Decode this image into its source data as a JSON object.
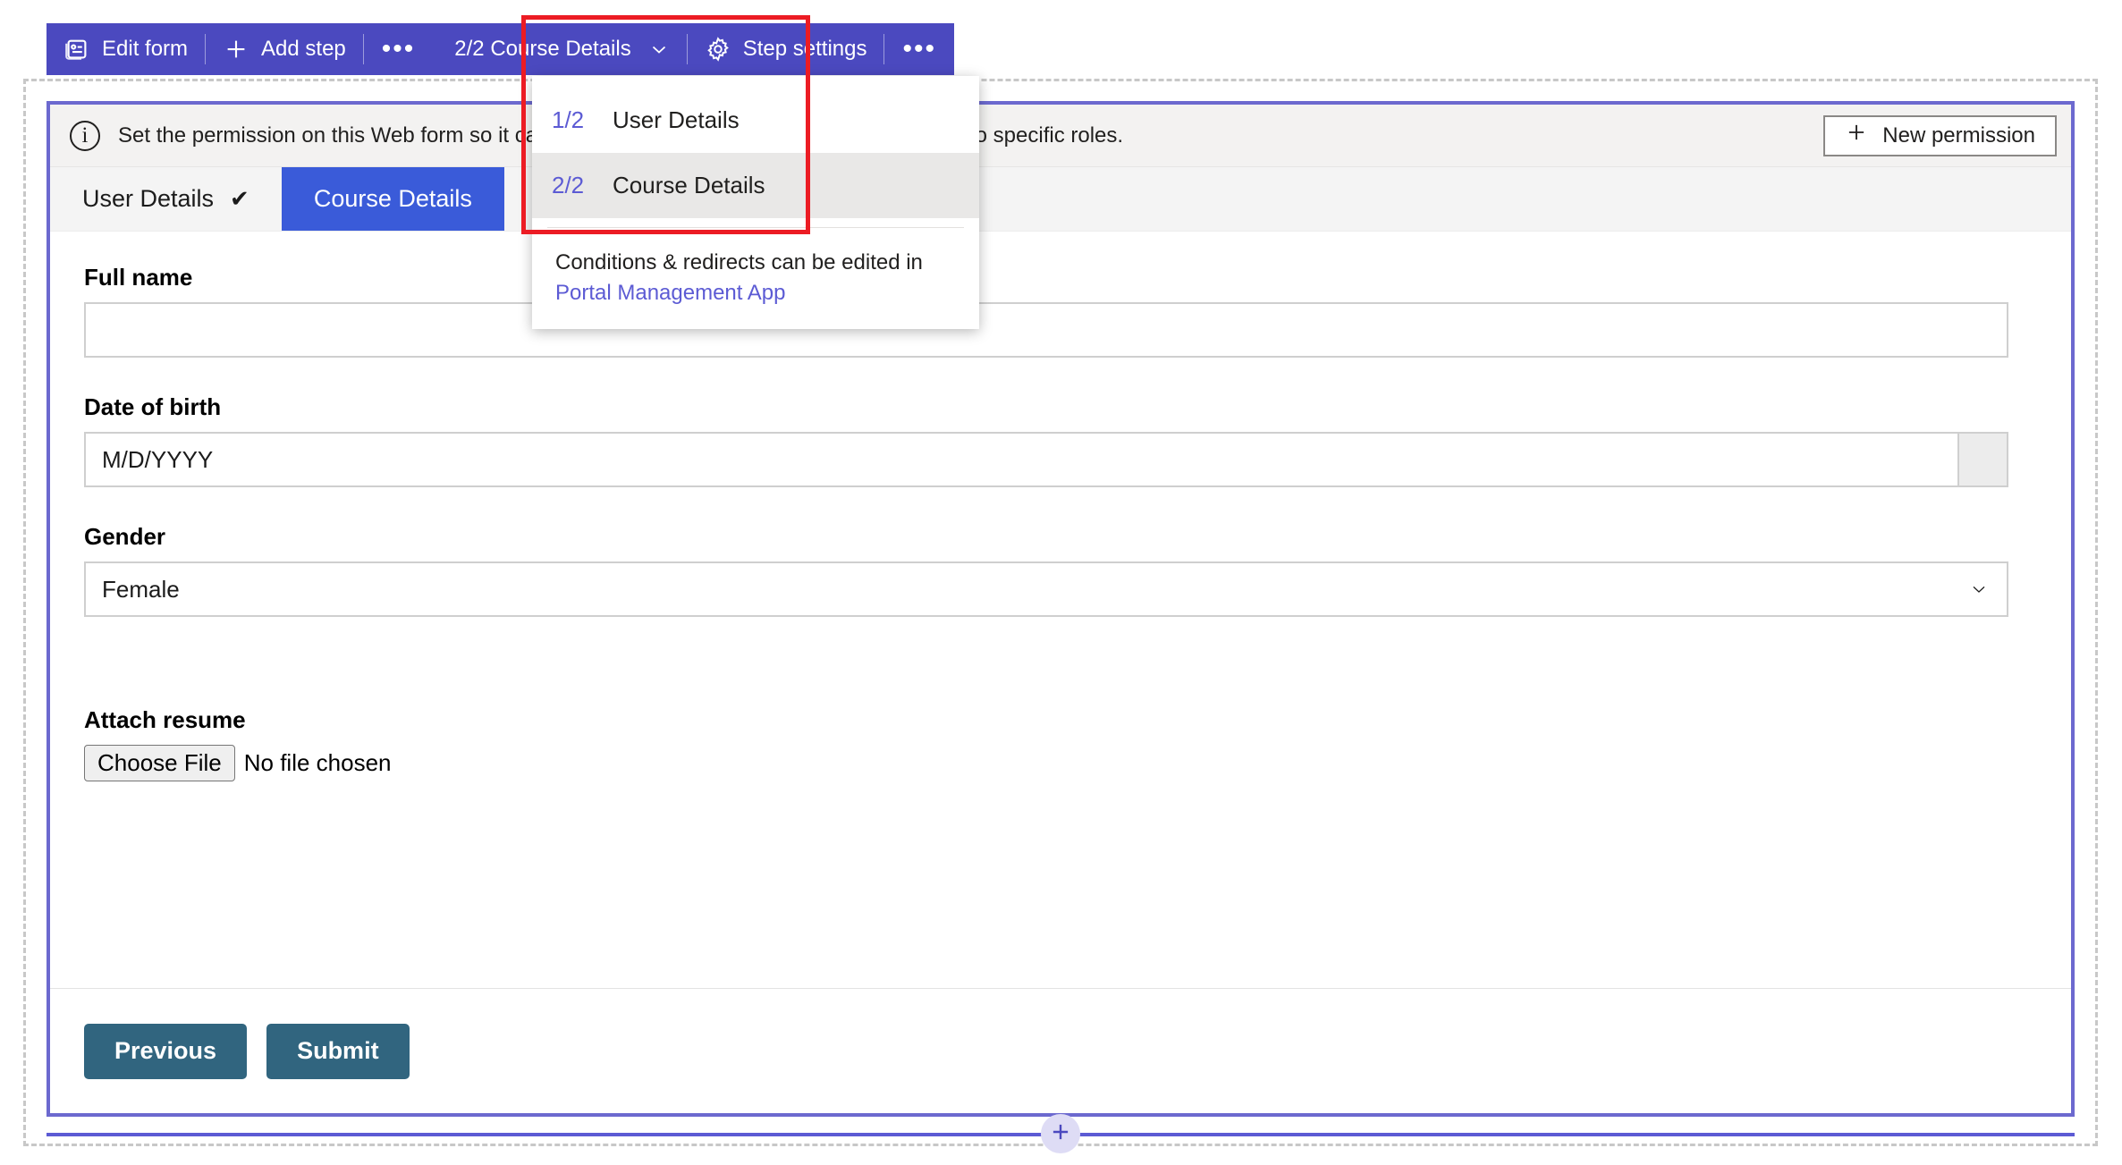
{
  "toolbar": {
    "edit_form_label": "Edit form",
    "edit_form_icon": "form-icon",
    "add_step_label": "Add step",
    "add_step_icon": "plus-icon",
    "overflow_left_label": "•••",
    "step_selector_label": "2/2 Course Details",
    "step_selector_caret_icon": "chevron-down-icon",
    "step_settings_label": "Step settings",
    "step_settings_icon": "gear-icon",
    "overflow_right_label": "•••",
    "accent_color": "#4b49bf"
  },
  "step_menu": {
    "items": [
      {
        "number": "1/2",
        "label": "User Details",
        "selected": false
      },
      {
        "number": "2/2",
        "label": "Course Details",
        "selected": true
      }
    ],
    "note_text": "Conditions & redirects can be edited in",
    "note_link": "Portal Management App"
  },
  "highlight": {
    "color": "#ec1c24"
  },
  "permission_bar": {
    "info_icon": "info-icon",
    "info_glyph": "i",
    "message": "Set the permission on this Web form so it can be accessed publicly or limit the interaction to specific roles.",
    "new_permission_label": "New permission",
    "new_permission_icon": "plus-icon"
  },
  "tabs": [
    {
      "label": "User Details",
      "active": false,
      "check_icon": "check-icon",
      "check_glyph": "✔"
    },
    {
      "label": "Course Details",
      "active": true,
      "check_icon": "",
      "check_glyph": ""
    }
  ],
  "form": {
    "fields": {
      "full_name": {
        "label": "Full name",
        "value": "",
        "placeholder": ""
      },
      "date_of_birth": {
        "label": "Date of birth",
        "value": "",
        "placeholder": "M/D/YYYY",
        "picker_icon": "calendar-icon"
      },
      "gender": {
        "label": "Gender",
        "value": "Female",
        "options": [
          "Female"
        ],
        "caret_icon": "chevron-down-icon"
      },
      "attach_resume": {
        "label": "Attach resume",
        "button_label": "Choose File",
        "status": "No file chosen"
      }
    },
    "actions": {
      "previous_label": "Previous",
      "submit_label": "Submit",
      "button_color": "#31657f"
    }
  },
  "add_section": {
    "icon": "plus-icon",
    "accent_color": "#5c5bd4"
  }
}
